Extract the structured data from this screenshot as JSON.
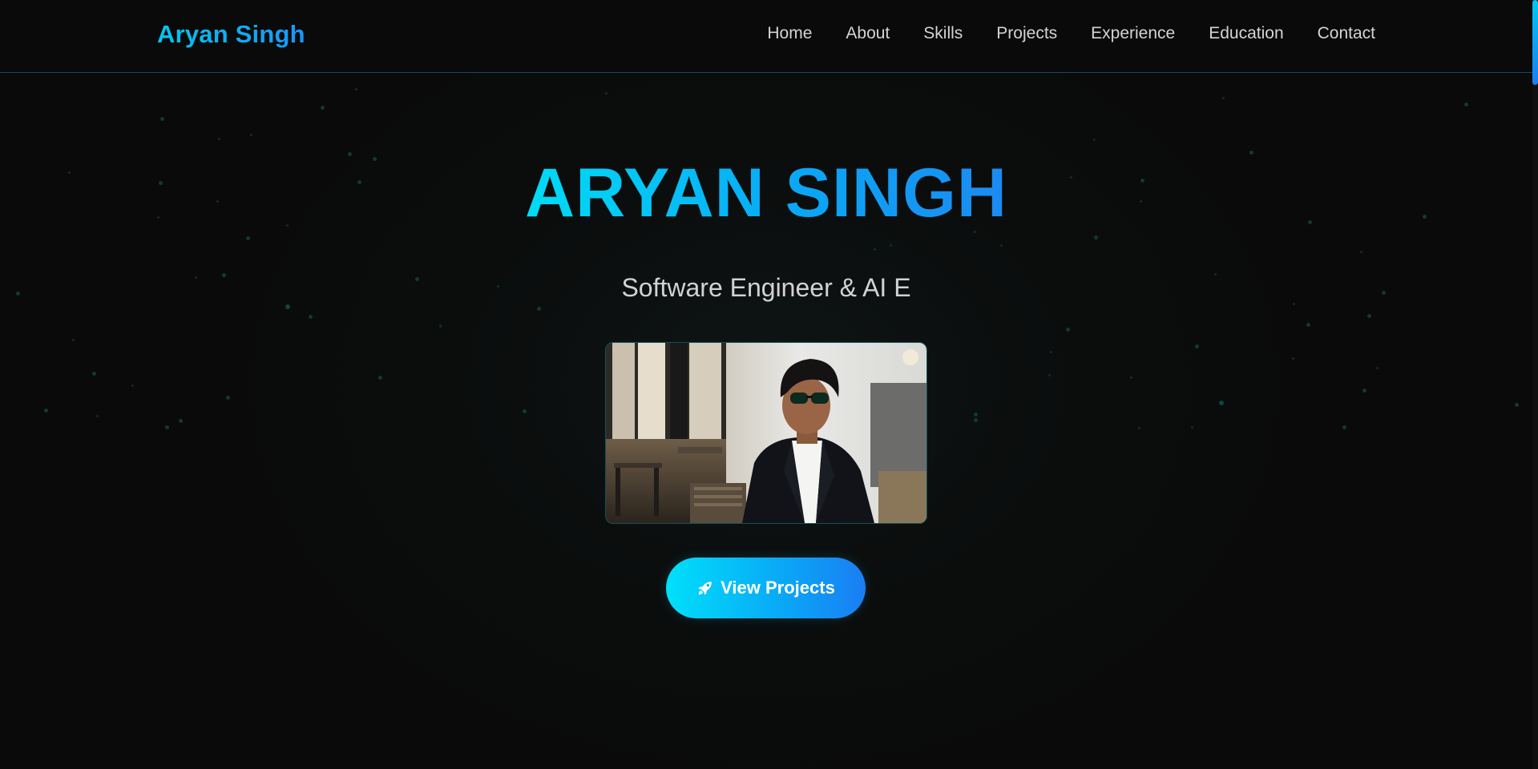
{
  "navbar": {
    "brand": "Aryan Singh",
    "links": [
      "Home",
      "About",
      "Skills",
      "Projects",
      "Experience",
      "Education",
      "Contact"
    ]
  },
  "hero": {
    "title": "ARYAN SINGH",
    "subtitle": "Software Engineer & AI E",
    "photo_icon": "profile-photo",
    "cta": {
      "icon": "rocket-icon",
      "label": "View Projects"
    }
  },
  "colors": {
    "background": "#0a0a0a",
    "accent_start": "#00dcf5",
    "accent_end": "#1a7ef4",
    "nav_text": "#d4d4d4",
    "navbar_border": "#0f4f55"
  }
}
